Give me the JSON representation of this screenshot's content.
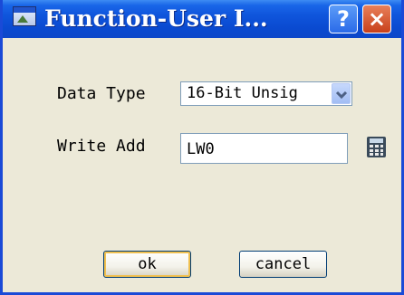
{
  "window": {
    "title": "Function-User I...",
    "help_label": "?",
    "close_label": "×"
  },
  "form": {
    "data_type_label": "Data Type",
    "data_type_value": "16-Bit Unsig",
    "write_add_label": "Write Add",
    "write_add_value": "LW0"
  },
  "buttons": {
    "ok_label": "ok",
    "cancel_label": "cancel"
  },
  "icons": {
    "title_icon": "window-app-icon",
    "dropdown": "chevron-down-icon",
    "calculator": "calculator-icon"
  },
  "colors": {
    "titlebar": "#0a4ad0",
    "dialog_bg": "#ece9d8",
    "close_button": "#c8401a",
    "help_button": "#2a6ae8"
  }
}
